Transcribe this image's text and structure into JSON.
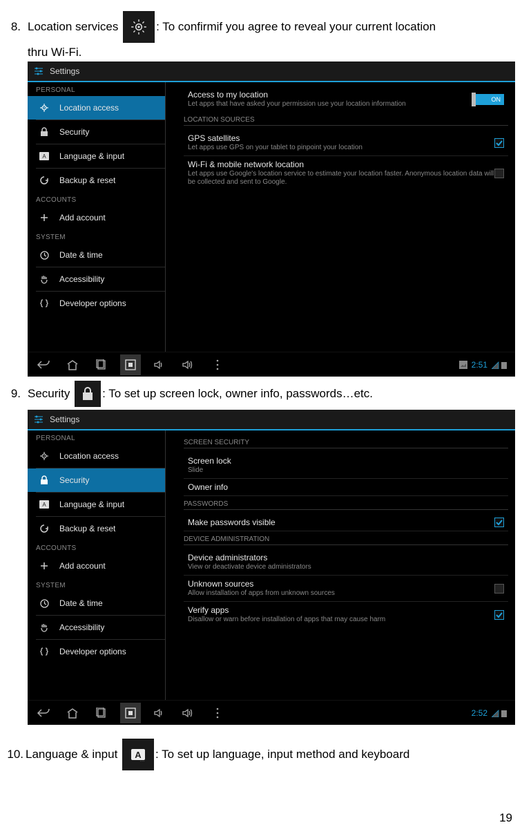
{
  "page_number": "19",
  "items": {
    "i8": {
      "num": "8.",
      "pre": "Location services",
      "post": ": To confirmif you agree to reveal your current location",
      "line2": "thru Wi-Fi."
    },
    "i9": {
      "num": "9.",
      "pre": "Security",
      "post": ": To set up screen lock, owner info, passwords…etc."
    },
    "i10": {
      "num": "10.",
      "pre": "Language & input",
      "post": ": To set up language, input method and keyboard"
    }
  },
  "settings_title": "Settings",
  "sidebar": {
    "cat_personal": "PERSONAL",
    "location_access": "Location access",
    "security": "Security",
    "language_input": "Language & input",
    "backup_reset": "Backup & reset",
    "cat_accounts": "ACCOUNTS",
    "add_account": "Add account",
    "cat_system": "SYSTEM",
    "date_time": "Date & time",
    "accessibility": "Accessibility",
    "developer": "Developer options"
  },
  "shot1": {
    "access_title": "Access to my location",
    "access_sub": "Let apps that have asked your permission use your location information",
    "toggle_text": "ON",
    "cat_sources": "LOCATION SOURCES",
    "gps_title": "GPS satellites",
    "gps_sub": "Let apps use GPS on your tablet to pinpoint your location",
    "wifi_title": "Wi-Fi & mobile network location",
    "wifi_sub": "Let apps use Google's location service to estimate your location faster. Anonymous location data will be collected and sent to Google.",
    "clock": "2:51"
  },
  "shot2": {
    "cat_screen": "SCREEN SECURITY",
    "lock_title": "Screen lock",
    "lock_sub": "Slide",
    "owner_title": "Owner info",
    "cat_pw": "PASSWORDS",
    "pw_title": "Make passwords visible",
    "cat_admin": "DEVICE ADMINISTRATION",
    "admin_title": "Device administrators",
    "admin_sub": "View or deactivate device administrators",
    "unknown_title": "Unknown sources",
    "unknown_sub": "Allow installation of apps from unknown sources",
    "verify_title": "Verify apps",
    "verify_sub": "Disallow or warn before installation of apps that may cause harm",
    "clock": "2:52"
  }
}
